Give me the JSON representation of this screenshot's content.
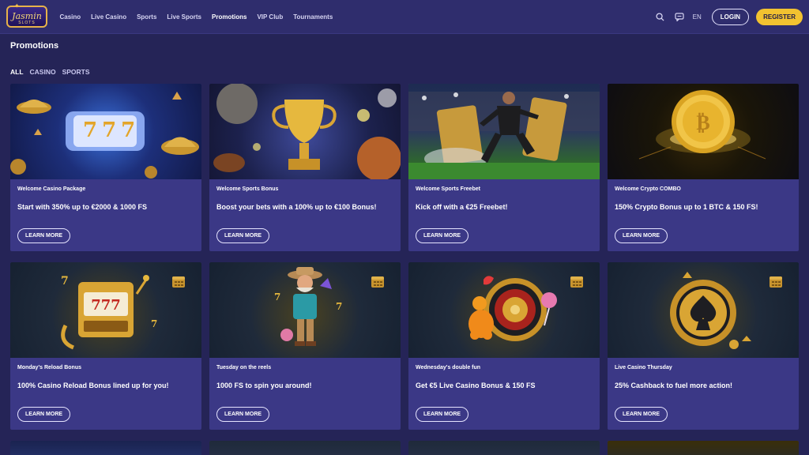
{
  "brand": {
    "logo_text": "Jasmin",
    "logo_sub": "SLOTS"
  },
  "nav": [
    {
      "label": "Casino",
      "active": false
    },
    {
      "label": "Live Casino",
      "active": false
    },
    {
      "label": "Sports",
      "active": false
    },
    {
      "label": "Live Sports",
      "active": false
    },
    {
      "label": "Promotions",
      "active": true
    },
    {
      "label": "VIP Club",
      "active": false
    },
    {
      "label": "Tournaments",
      "active": false
    }
  ],
  "header": {
    "language": "EN",
    "login_label": "LOGIN",
    "register_label": "REGISTER"
  },
  "page": {
    "title": "Promotions"
  },
  "filters": [
    {
      "label": "ALL",
      "active": true
    },
    {
      "label": "CASINO",
      "active": false
    },
    {
      "label": "SPORTS",
      "active": false
    }
  ],
  "promos": [
    {
      "tag": "Welcome Casino Package",
      "title": "Start with 350% up to €2000 & 1000 FS",
      "button": "LEARN MORE"
    },
    {
      "tag": "Welcome Sports Bonus",
      "title": "Boost your bets with a 100% up to €100 Bonus!",
      "button": "LEARN MORE"
    },
    {
      "tag": "Welcome Sports Freebet",
      "title": "Kick off with a €25 Freebet!",
      "button": "LEARN MORE"
    },
    {
      "tag": "Welcome Crypto COMBO",
      "title": "150% Crypto Bonus up to 1 BTC & 150 FS!",
      "button": "LEARN MORE"
    },
    {
      "tag": "Monday's Reload Bonus",
      "title": "100% Casino Reload Bonus lined up for you!",
      "button": "LEARN MORE"
    },
    {
      "tag": "Tuesday on the reels",
      "title": "1000 FS to spin you around!",
      "button": "LEARN MORE"
    },
    {
      "tag": "Wednesday's double fun",
      "title": "Get €5 Live Casino Bonus & 150 FS",
      "button": "LEARN MORE"
    },
    {
      "tag": "Live Casino Thursday",
      "title": "25% Cashback to fuel more action!",
      "button": "LEARN MORE"
    }
  ],
  "slot_symbol": "777",
  "colors": {
    "accent": "#f2c230",
    "card": "#3b3886",
    "header": "#2f2d6d",
    "background": "#252457"
  }
}
